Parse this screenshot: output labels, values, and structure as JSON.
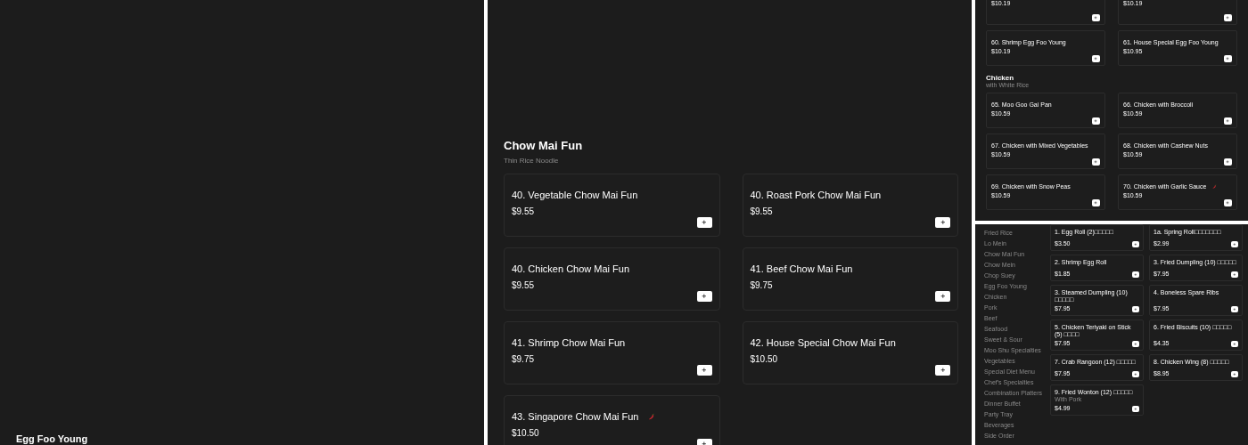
{
  "left_panel": {
    "heading": "Egg Foo Young"
  },
  "middle_panel": {
    "title": "Chow Mai Fun",
    "subtitle": "Thin Rice Noodle",
    "items": [
      {
        "name": "40. Vegetable Chow Mai Fun",
        "price": "$9.55",
        "spicy": false
      },
      {
        "name": "40. Roast Pork Chow Mai Fun",
        "price": "$9.55",
        "spicy": false
      },
      {
        "name": "40. Chicken Chow Mai Fun",
        "price": "$9.55",
        "spicy": false
      },
      {
        "name": "41. Beef Chow Mai Fun",
        "price": "$9.75",
        "spicy": false
      },
      {
        "name": "41. Shrimp Chow Mai Fun",
        "price": "$9.75",
        "spicy": false
      },
      {
        "name": "42. House Special Chow Mai Fun",
        "price": "$10.50",
        "spicy": false
      },
      {
        "name": "43. Singapore Chow Mai Fun",
        "price": "$10.50",
        "spicy": true
      }
    ]
  },
  "right_top_panel": {
    "sections": [
      {
        "items": [
          {
            "price": "$10.19"
          },
          {
            "price": "$10.19"
          },
          {
            "name": "60. Shrimp Egg Foo Young",
            "price": "$10.19",
            "spicy": false
          },
          {
            "name": "61. House Special Egg Foo Young",
            "price": "$10.95",
            "spicy": false
          }
        ]
      },
      {
        "title": "Chicken",
        "subtitle": "with White Rice",
        "items": [
          {
            "name": "65. Moo Goo Gai Pan",
            "price": "$10.59",
            "spicy": false
          },
          {
            "name": "66. Chicken with Broccoli",
            "price": "$10.59",
            "spicy": false
          },
          {
            "name": "67. Chicken with Mixed Vegetables",
            "price": "$10.59",
            "spicy": false
          },
          {
            "name": "68. Chicken with Cashew Nuts",
            "price": "$10.59",
            "spicy": false
          },
          {
            "name": "69. Chicken with Snow Peas",
            "price": "$10.59",
            "spicy": false
          },
          {
            "name": "70. Chicken with Garlic Sauce",
            "price": "$10.59",
            "spicy": true
          }
        ]
      }
    ]
  },
  "right_bottom_panel": {
    "sidebar": [
      "Fried Rice",
      "Lo Mein",
      "Chow Mai Fun",
      "Chow Mein",
      "Chop Suey",
      "Egg Foo Young",
      "Chicken",
      "Pork",
      "Beef",
      "Seafood",
      "Sweet & Sour",
      "Moo Shu Specialties",
      "Vegetables",
      "Special Diet Menu",
      "Chef's Specialties",
      "Combination Platters",
      "Dinner Buffet",
      "Party Tray",
      "Beverages",
      "Side Order"
    ],
    "items": [
      {
        "name": "1. Egg Roll (2)□□□□□",
        "price": "$3.50",
        "spicy": false
      },
      {
        "name": "1a. Spring Roll□□□□□□□",
        "price": "$2.99",
        "spicy": false
      },
      {
        "name": "2. Shrimp Egg Roll",
        "price": "$1.85",
        "spicy": false
      },
      {
        "name": "3. Fried Dumpling (10) □□□□□",
        "price": "$7.95",
        "spicy": false
      },
      {
        "name": "3. Steamed Dumpling (10) □□□□□",
        "price": "$7.95",
        "spicy": false
      },
      {
        "name": "4. Boneless Spare Ribs",
        "price": "$7.95",
        "spicy": false
      },
      {
        "name": "5. Chicken Teriyaki on Stick (5) □□□□",
        "price": "$7.95",
        "spicy": false
      },
      {
        "name": "6. Fried Biscuits (10) □□□□□",
        "price": "$4.35",
        "spicy": false
      },
      {
        "name": "7. Crab Rangoon (12) □□□□□",
        "price": "$7.95",
        "spicy": false
      },
      {
        "name": "8. Chicken Wing (8) □□□□□",
        "price": "$8.95",
        "spicy": false
      },
      {
        "name": "9. Fried Wonton (12) □□□□□",
        "note": "With Pork",
        "price": "$4.99",
        "spicy": false
      }
    ]
  }
}
